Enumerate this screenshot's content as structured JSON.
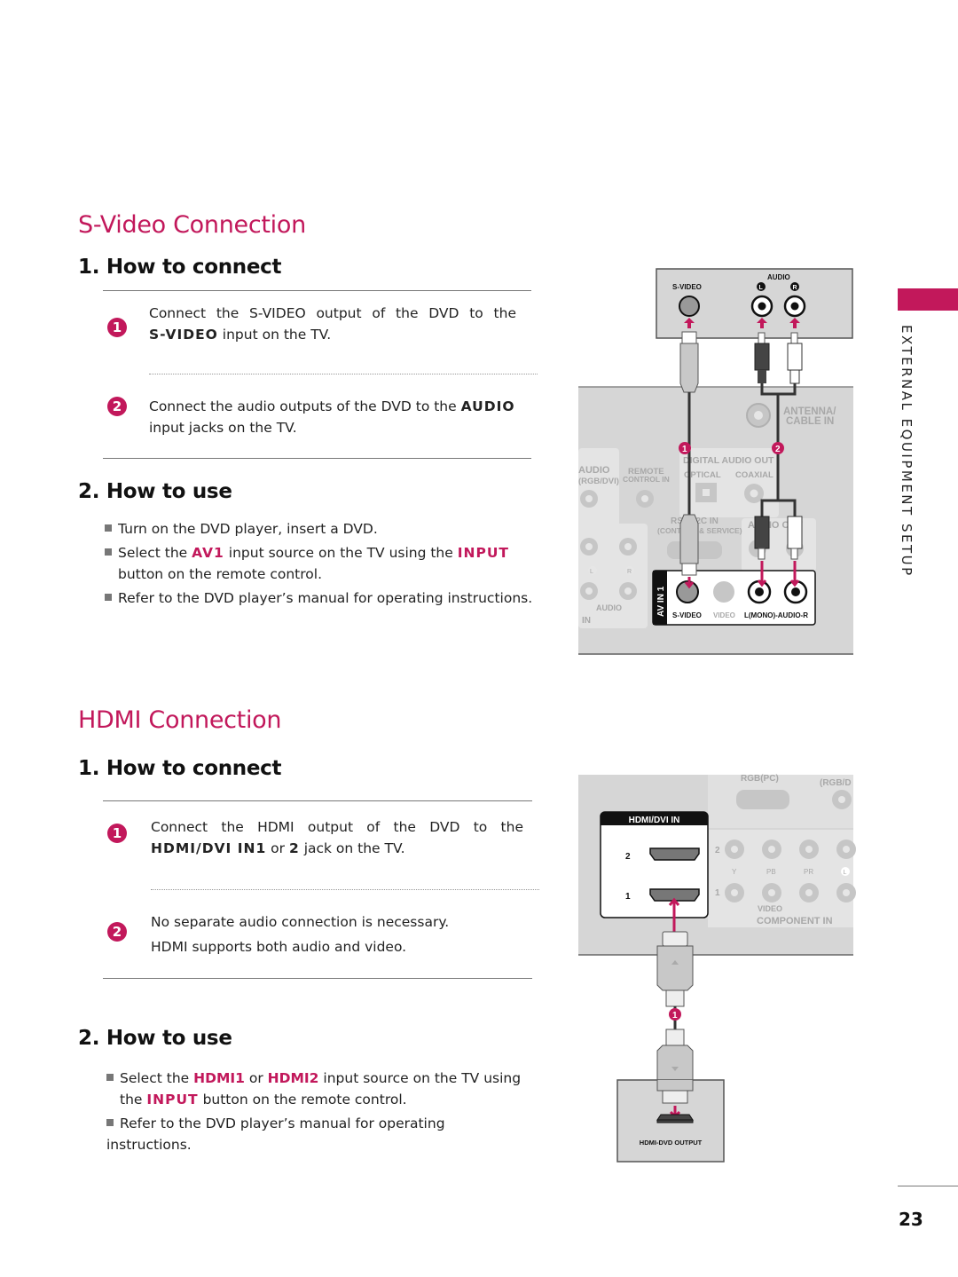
{
  "svideo": {
    "title": "S-Video Connection",
    "connect": {
      "heading": "1. How to connect",
      "steps": [
        {
          "num": "1",
          "line1": "Connect the S-VIDEO output of the DVD to the",
          "line2_bold": "S-VIDEO",
          "line2_rest": " input on the TV."
        },
        {
          "num": "2",
          "line1_pre": "Connect the audio outputs of the DVD to the ",
          "line1_bold": "AUDIO",
          "line2": "input jacks on the TV."
        }
      ]
    },
    "use": {
      "heading": "2. How to use",
      "bullets": [
        {
          "text": "Turn on the DVD player, insert a DVD."
        },
        {
          "pre": "Select the ",
          "accent1": "AV1",
          "mid": " input source on the TV using the ",
          "accent2": "INPUT",
          "line2": "button on the remote control."
        },
        {
          "text": "Refer to the DVD player’s manual for operating instructions."
        }
      ]
    },
    "diagram": {
      "dvd_labels": {
        "svideo": "S-VIDEO",
        "audio": "AUDIO",
        "left": "L",
        "right": "R"
      },
      "tv_labels": {
        "antenna": "ANTENNA/",
        "cable_in": "CABLE IN",
        "digital_audio_out": "DIGITAL AUDIO OUT",
        "optical": "OPTICAL",
        "coaxial": "COAXIAL",
        "audio_rgb": "AUDIO",
        "rgb_dvi": "(RGB/DVI)",
        "remote": "REMOTE",
        "control_in": "CONTROL IN",
        "rs232c": "RS-232C IN",
        "control_service": "(CONTROL & SERVICE)",
        "audio_out": "AUDIO OUT",
        "l": "L",
        "r": "R",
        "audio_bracket": "AUDIO",
        "in": "IN",
        "av_in_1": "AV IN 1",
        "jack_svideo": "S-VIDEO",
        "jack_video": "VIDEO",
        "jack_audio": "L(MONO)-AUDIO-R"
      },
      "markers": [
        "1",
        "2"
      ]
    }
  },
  "hdmi": {
    "title": "HDMI Connection",
    "connect": {
      "heading": "1. How to connect",
      "steps": [
        {
          "num": "1",
          "line1": "Connect the HDMI output of the DVD to the",
          "line2_bold1": "HDMI/DVI IN1",
          "line2_mid": " or ",
          "line2_bold2": "2",
          "line2_rest": " jack on the TV."
        },
        {
          "num": "2",
          "line1": "No separate audio connection is necessary.",
          "line2": "HDMI supports both audio and video."
        }
      ]
    },
    "use": {
      "heading": "2. How to use",
      "bullets": [
        {
          "pre": "Select the ",
          "accent1": "HDMI1",
          "mid": " or ",
          "accent2": "HDMI2",
          "post": " input source on the TV using",
          "line2_pre": "the ",
          "line2_accent": "INPUT",
          "line2_post": " button on the remote control."
        },
        {
          "text": "Refer to the DVD player’s manual for operating instructions."
        }
      ]
    },
    "diagram": {
      "tv_labels": {
        "rgb_pc": "RGB(PC)",
        "rgb_dvi": "(RGB/D",
        "hdmi_dvi_in": "HDMI/DVI IN",
        "port2": "2",
        "port1": "1",
        "comp2": "2",
        "comp1": "1",
        "y": "Y",
        "pb": "PB",
        "pr": "PR",
        "l": "L",
        "video": "VIDEO",
        "component_in": "COMPONENT IN"
      },
      "dvd_label": "HDMI-DVD OUTPUT",
      "marker": "1"
    }
  },
  "side": {
    "label": "EXTERNAL EQUIPMENT SETUP"
  },
  "page_number": "23",
  "colors": {
    "accent": "#c2185b",
    "panel": "#d9d9d9",
    "text": "#222222"
  }
}
